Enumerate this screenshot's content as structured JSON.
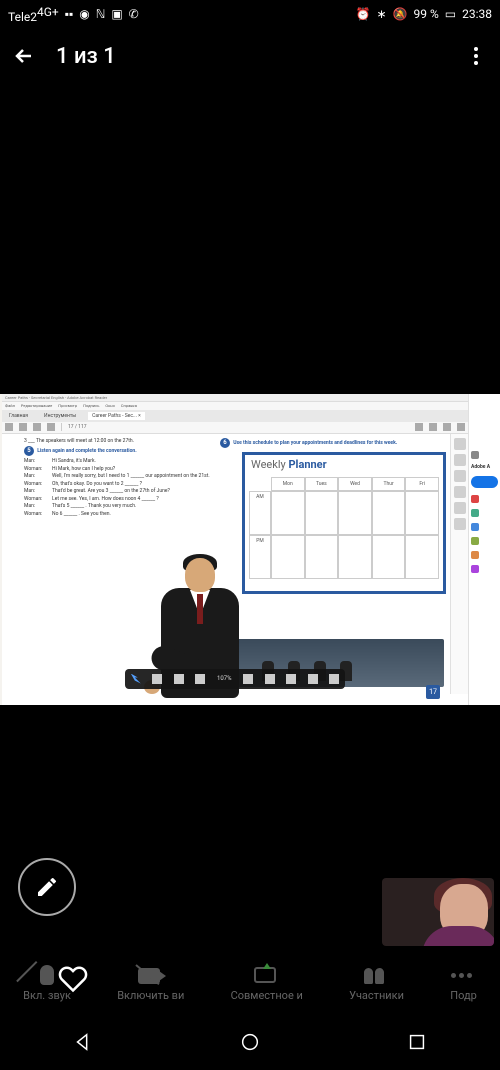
{
  "status": {
    "carrier": "Tele2",
    "signal_sup": "4G+",
    "time": "23:38",
    "battery": "99 %"
  },
  "header": {
    "title": "1 из 1"
  },
  "pdf": {
    "window_title": "Career Paths - Secretarial English - Adobe Acrobat Reader",
    "menu": [
      "Файл",
      "Редактирование",
      "Просмотр",
      "Подпись",
      "Окно",
      "Справка"
    ],
    "tabs": [
      "Главная",
      "Инструменты",
      "Career Paths - Sec... ×"
    ],
    "page_indicator": "17 / 117",
    "zoom": "107%",
    "page_number": "17",
    "right_title": "Adobe A"
  },
  "page": {
    "line3": "3 ___ The speakers will meet at 12:00 on the 27th.",
    "ex5_num": "5",
    "ex5_text": "Listen again and complete the conversation.",
    "ex6_num": "6",
    "ex6_text": "Use this schedule to plan your appointments and deadlines for this week.",
    "dialogue": [
      {
        "sp": "Man:",
        "tx": "Hi Sandra, it's Mark."
      },
      {
        "sp": "Woman:",
        "tx": "Hi Mark, how can I help you?"
      },
      {
        "sp": "Man:",
        "tx": "Well, I'm really sorry, but I need to 1 ______ our appointment on the 21st."
      },
      {
        "sp": "Woman:",
        "tx": "Oh, that's okay. Do you want to 2 ______ ?"
      },
      {
        "sp": "Man:",
        "tx": "That'd be great. Are you 3 ______ on the 27th of June?"
      },
      {
        "sp": "Woman:",
        "tx": "Let me see. Yes, I am. How does noon 4 ______ ?"
      },
      {
        "sp": "Man:",
        "tx": "That's 5 ______ . Thank you very much."
      },
      {
        "sp": "Woman:",
        "tx": "No 6 ______ . See you then."
      }
    ],
    "planner": {
      "title_a": "Weekly",
      "title_b": "Planner",
      "days": [
        "Mon",
        "Tues",
        "Wed",
        "Thur",
        "Fri"
      ],
      "rows": [
        "AM",
        "PM"
      ]
    }
  },
  "meeting": {
    "items": [
      "Вкл. звук",
      "Включить ви",
      "Совместное и",
      "Участники",
      "Подр"
    ]
  }
}
